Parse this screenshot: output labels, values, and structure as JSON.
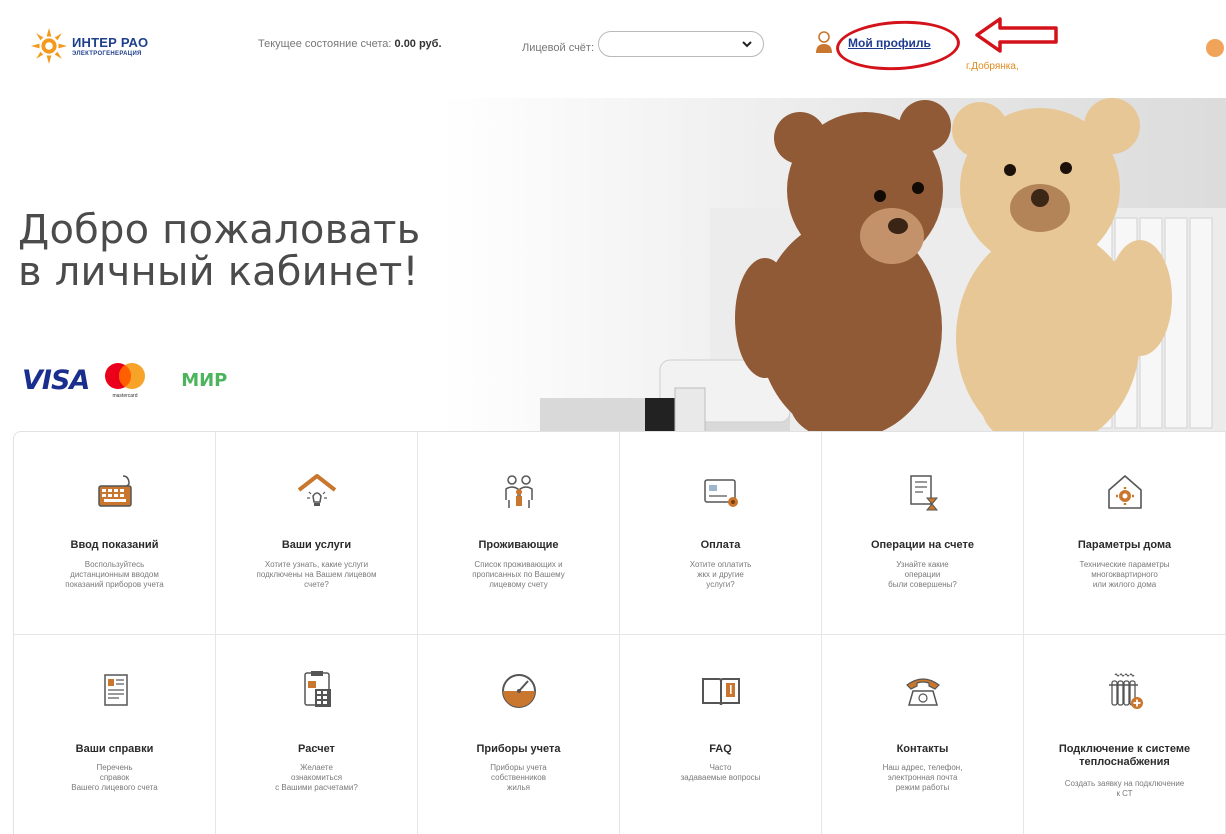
{
  "header": {
    "logo": {
      "main": "ИНТЕР РАО",
      "sub": "ЭЛЕКТРОГЕНЕРАЦИЯ"
    },
    "balance_label": "Текущее состояние счета:",
    "balance_value": "0.00 руб.",
    "account_label": "Лицевой счёт:",
    "account_value": "",
    "profile_link": "Мой профиль",
    "city": "г.Добрянка,"
  },
  "banner": {
    "welcome_line1": "Добро пожаловать",
    "welcome_line2": "в личный кабинет!",
    "visa": "VISA",
    "mastercard_small": "mastercard",
    "mir": "МИР"
  },
  "colors": {
    "accent_red": "#d4121a",
    "link_blue": "#1f3b8f",
    "city_orange": "#e08a1e",
    "icon_orange": "#c9772e",
    "icon_gray": "#555555"
  },
  "tiles": [
    {
      "icon": "keyboard-icon",
      "title": "Ввод показаний",
      "desc": "Воспользуйтесь\nдистанционным вводом\nпоказаний приборов учета"
    },
    {
      "icon": "lamp-house-icon",
      "title": "Ваши услуги",
      "desc": "Хотите узнать, какие услуги\nподключены на Вашем лицевом\nсчете?"
    },
    {
      "icon": "residents-icon",
      "title": "Проживающие",
      "desc": "Список проживающих и\nпрописанных по Вашему\nлицевому счету"
    },
    {
      "icon": "payment-card-icon",
      "title": "Оплата",
      "desc": "Хотите оплатить\nжкх и другие\nуслуги?"
    },
    {
      "icon": "document-hourglass-icon",
      "title": "Операции на счете",
      "desc": "Узнайте какие\nоперации\nбыли совершены?"
    },
    {
      "icon": "house-gear-icon",
      "title": "Параметры дома",
      "desc": "Технические параметры\nмногоквартирного\nили жилого дома"
    },
    {
      "icon": "certificate-icon",
      "title": "Ваши справки",
      "desc": "Перечень\nсправок\nВашего лицевого счета"
    },
    {
      "icon": "calculator-icon",
      "title": "Расчет",
      "desc": "Желаете\nознакомиться\nс Вашими расчетами?"
    },
    {
      "icon": "gauge-icon",
      "title": "Приборы учета",
      "desc": "Приборы учета\nсобственников\nжилья"
    },
    {
      "icon": "book-icon",
      "title": "FAQ",
      "desc": "Часто\nзадаваемые вопросы"
    },
    {
      "icon": "telephone-icon",
      "title": "Контакты",
      "desc": "Наш адрес, телефон,\nэлектронная почта\nрежим работы"
    },
    {
      "icon": "radiator-plus-icon",
      "title": "Подключение к системе теплоснабжения",
      "desc": "Создать заявку на подключение\nк СТ"
    }
  ]
}
